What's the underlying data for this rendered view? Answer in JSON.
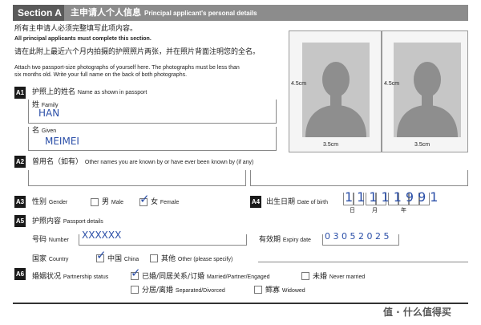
{
  "header": {
    "section_label": "Section A",
    "title_cn": "主申请人个人信息",
    "title_en": "Principal applicant's personal details"
  },
  "intro": {
    "line_cn": "所有主申请人必须完整填写此项内容。",
    "line_en": "All principal applicants must complete this section.",
    "photo_cn": "请在此附上最近六个月内拍摄的护照照片两张，并在照片背面注明您的全名。",
    "photo_en_1": "Attach two passport-size photographs of yourself here. The photographs must be less than",
    "photo_en_2": "six months old. Write your full name on the back of both photographs."
  },
  "photos": {
    "width_label": "3.5cm",
    "height_label": "4.5cm"
  },
  "a1": {
    "num": "A1",
    "label_cn": "护照上的姓名",
    "label_en": "Name as shown in passport",
    "family_cn": "姓",
    "family_en": "Family",
    "family_value": "HAN",
    "given_cn": "名",
    "given_en": "Given",
    "given_value": "MEIMEI"
  },
  "a2": {
    "num": "A2",
    "label_cn": "曾用名（如有）",
    "label_en": "Other names you are known by or have ever been known by (if any)"
  },
  "a3": {
    "num": "A3",
    "gender_cn": "性别",
    "gender_en": "Gender",
    "male_cn": "男",
    "male_en": "Male",
    "female_cn": "女",
    "female_en": "Female",
    "selected": "female",
    "tick_glyph": "✓"
  },
  "a4": {
    "num": "A4",
    "label_cn": "出生日期",
    "label_en": "Date of birth",
    "value": "11111991",
    "day_cn": "日",
    "month_cn": "月",
    "year_cn": "年"
  },
  "a5": {
    "num": "A5",
    "label_cn": "护照内容",
    "label_en": "Passport details",
    "number_cn": "号码",
    "number_en": "Number",
    "number_value": "XXXXXX",
    "expiry_cn": "有效期",
    "expiry_en": "Expiry date",
    "expiry_value": "0 3 0 5 2 0 2 5",
    "country_cn": "国家",
    "country_en": "Country",
    "china_cn": "中国",
    "china_en": "China",
    "other_cn": "其他",
    "other_en": "Other (please specify)"
  },
  "a6": {
    "num": "A6",
    "label_cn": "婚姻状况",
    "label_en": "Partnership status",
    "married_cn": "已婚/同居关系/订婚",
    "married_en": "Married/Partner/Engaged",
    "unmarried_cn": "未婚",
    "unmarried_en": "Never married",
    "separated_cn": "分居/离婚",
    "separated_en": "Separated/Divorced",
    "widowed_cn": "鳏寡",
    "widowed_en": "Widowed",
    "selected": "married"
  },
  "watermark": {
    "text": "值 · 什么值得买"
  }
}
